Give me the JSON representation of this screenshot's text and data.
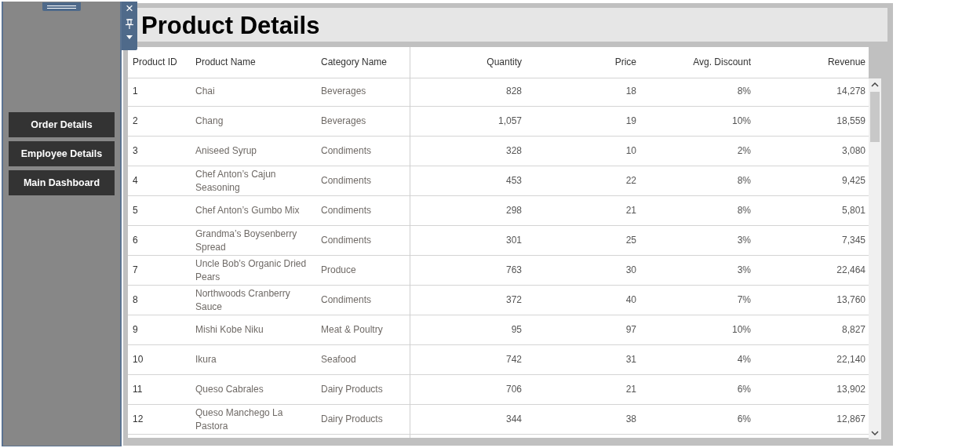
{
  "sidebar": {
    "buttons": [
      "Order Details",
      "Employee Details",
      "Main Dashboard"
    ]
  },
  "toolbar": {
    "close": "×"
  },
  "title": "Product Details",
  "table": {
    "columns": [
      "Product ID",
      "Product Name",
      "Category Name",
      "Quantity",
      "Price",
      "Avg. Discount",
      "Revenue"
    ],
    "rows": [
      [
        "1",
        "Chai",
        "Beverages",
        "828",
        "18",
        "8%",
        "14,278"
      ],
      [
        "2",
        "Chang",
        "Beverages",
        "1,057",
        "19",
        "10%",
        "18,559"
      ],
      [
        "3",
        "Aniseed Syrup",
        "Condiments",
        "328",
        "10",
        "2%",
        "3,080"
      ],
      [
        "4",
        "Chef Anton’s Cajun Seasoning",
        "Condiments",
        "453",
        "22",
        "8%",
        "9,425"
      ],
      [
        "5",
        "Chef Anton’s Gumbo Mix",
        "Condiments",
        "298",
        "21",
        "8%",
        "5,801"
      ],
      [
        "6",
        "Grandma’s Boysenberry Spread",
        "Condiments",
        "301",
        "25",
        "3%",
        "7,345"
      ],
      [
        "7",
        "Uncle Bob’s Organic Dried Pears",
        "Produce",
        "763",
        "30",
        "3%",
        "22,464"
      ],
      [
        "8",
        "Northwoods Cranberry Sauce",
        "Condiments",
        "372",
        "40",
        "7%",
        "13,760"
      ],
      [
        "9",
        "Mishi Kobe Niku",
        "Meat & Poultry",
        "95",
        "97",
        "10%",
        "8,827"
      ],
      [
        "10",
        "Ikura",
        "Seafood",
        "742",
        "31",
        "4%",
        "22,140"
      ],
      [
        "11",
        "Queso Cabrales",
        "Dairy Products",
        "706",
        "21",
        "6%",
        "13,902"
      ],
      [
        "12",
        "Queso Manchego La Pastora",
        "Dairy Products",
        "344",
        "38",
        "6%",
        "12,867"
      ]
    ]
  }
}
